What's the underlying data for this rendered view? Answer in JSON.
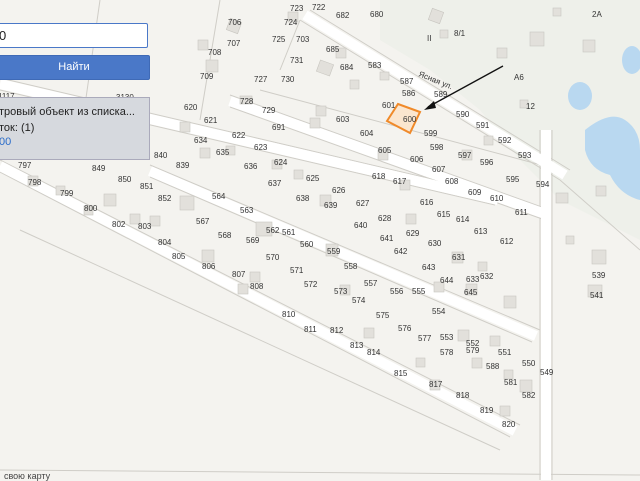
{
  "search": {
    "value": "0"
  },
  "find_button": {
    "label": "Найти"
  },
  "result": {
    "line1": "тровый объект из списка...",
    "line2": "ток: (1)",
    "line3": "00"
  },
  "footer": {
    "text": "свою карту"
  },
  "map": {
    "street_label": "Ясная ул.",
    "highlighted_parcel": "600",
    "colors": {
      "water": "#b9d8f0",
      "highlight": "#f08a2a",
      "roads": "#ffffff",
      "buildings": "#e2e0db"
    },
    "lot_numbers": [
      "706",
      "723",
      "722",
      "724",
      "680",
      "682",
      "2А",
      "707",
      "708",
      "725",
      "703",
      "731",
      "685",
      "709",
      "727",
      "730",
      "684",
      "583",
      "587",
      "589",
      "590",
      "591",
      "592",
      "593",
      "594",
      "595",
      "596",
      "597",
      "598",
      "599",
      "601",
      "600",
      "603",
      "604",
      "605",
      "606",
      "607",
      "608",
      "609",
      "610",
      "611",
      "612",
      "613",
      "614",
      "615",
      "616",
      "617",
      "618",
      "620",
      "621",
      "622",
      "623",
      "624",
      "625",
      "626",
      "627",
      "628",
      "629",
      "630",
      "631",
      "632",
      "633",
      "634",
      "635",
      "636",
      "637",
      "638",
      "639",
      "640",
      "641",
      "642",
      "643",
      "644",
      "645",
      "552",
      "553",
      "554",
      "555",
      "556",
      "557",
      "558",
      "559",
      "560",
      "561",
      "562",
      "563",
      "564",
      "565",
      "566",
      "567",
      "568",
      "569",
      "570",
      "571",
      "572",
      "573",
      "574",
      "575",
      "576",
      "577",
      "578",
      "579",
      "580",
      "549",
      "550",
      "551",
      "539",
      "541",
      "728",
      "729",
      "691",
      "840",
      "849",
      "850",
      "851",
      "852",
      "804",
      "805",
      "806",
      "807",
      "808",
      "810",
      "811",
      "812",
      "813",
      "814",
      "815",
      "817",
      "818",
      "819",
      "820",
      "797",
      "798",
      "799",
      "800",
      "802",
      "803",
      "586",
      "582",
      "12",
      "II",
      "8/1",
      "А6",
      "590"
    ]
  }
}
